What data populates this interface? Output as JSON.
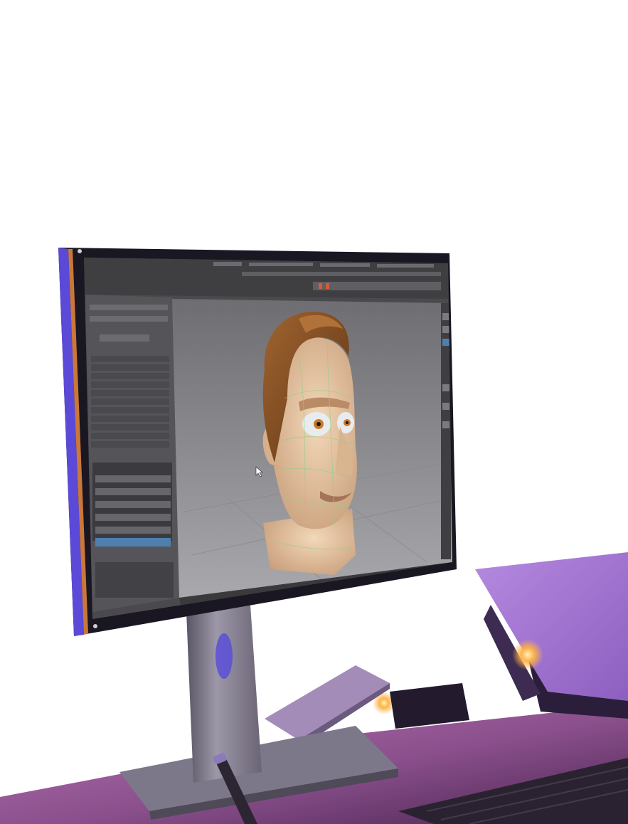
{
  "scene": {
    "description_free": true,
    "colors": {
      "background": "#ffffff",
      "bezel": "#1a1722",
      "bezel_edge_left": "#5b49d8",
      "bezel_edge_orange": "#c9783a",
      "viewport_top": "#6f6f73",
      "viewport_bottom": "#a6a6aa",
      "panel": "#5a5a5e",
      "panel_dark": "#454548",
      "toolbar": "#3f3f42",
      "skin": "#e8c9a6",
      "skin_shadow": "#c9a07d",
      "hair": "#8a5428",
      "hair_shadow": "#5e3414",
      "wire": "#8fcf8a",
      "iris": "#c77a2a",
      "stand": "#8c8697",
      "stand_shadow": "#4e4a58",
      "desk": "#6b3e7a",
      "desk_light": "#b36fa6",
      "laptop": "#a77ad6",
      "laptop_dark": "#3d2b52",
      "tablet": "#a68fb8",
      "glow": "#ffb347"
    },
    "icons": [
      "mouse-cursor-icon"
    ]
  }
}
